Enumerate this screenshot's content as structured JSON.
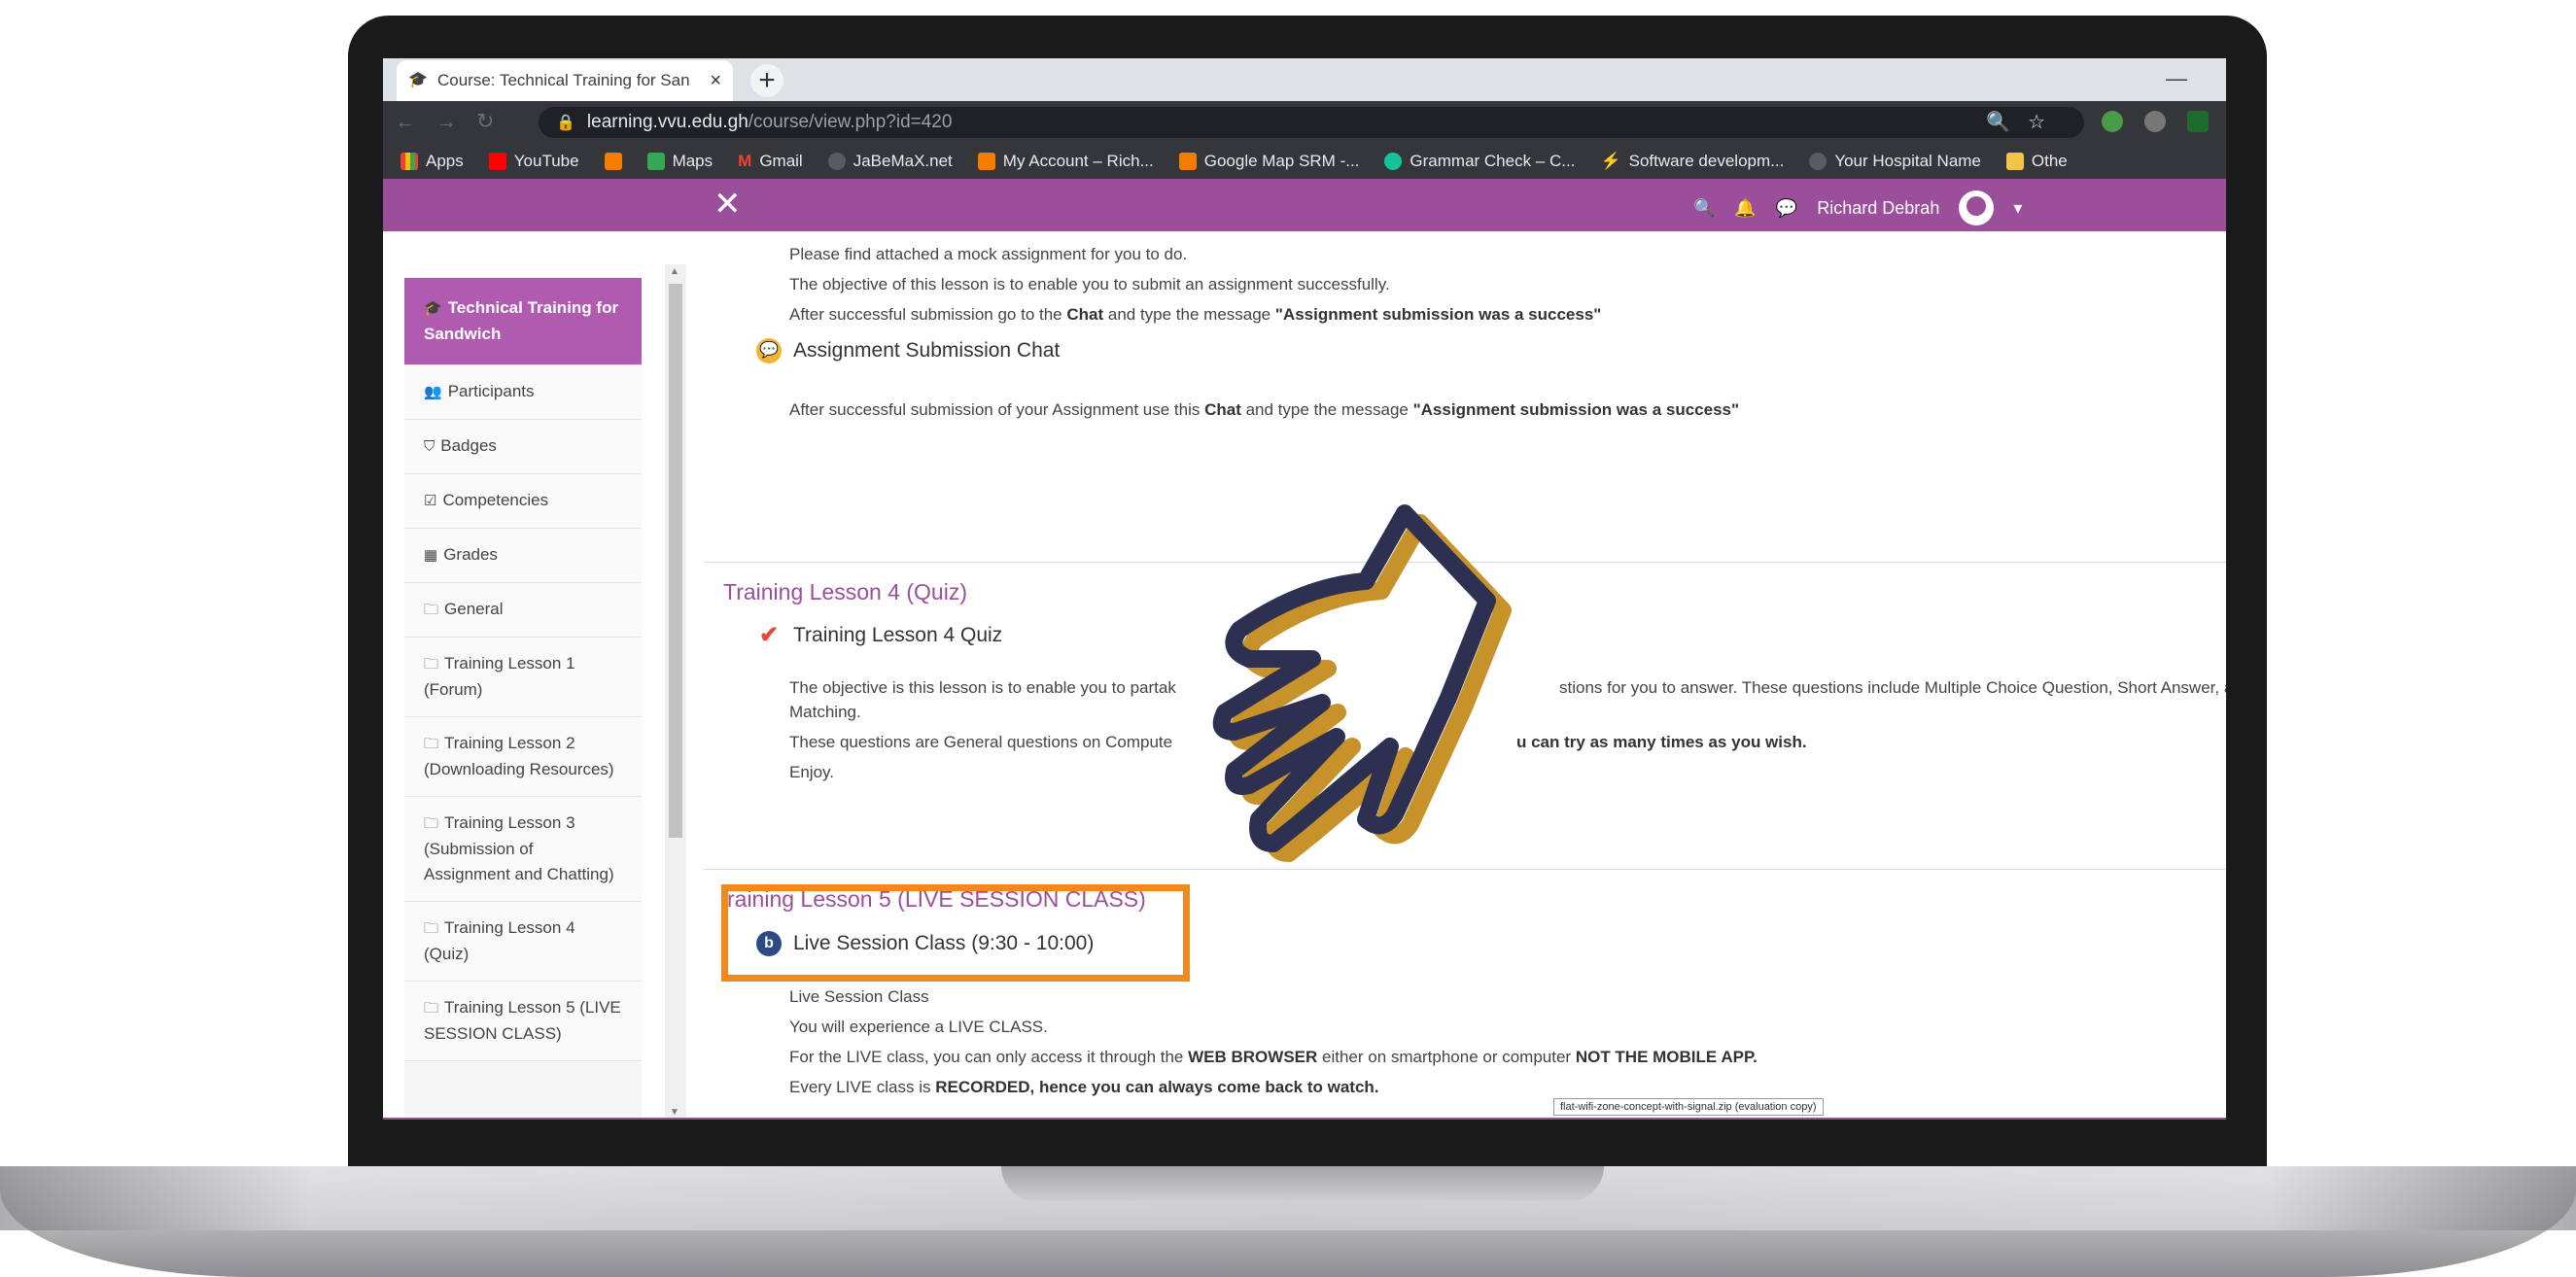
{
  "browser": {
    "tab_title": "Course: Technical Training for San",
    "new_tab": "+",
    "url_host": "learning.vvu.edu.gh",
    "url_path": "/course/view.php?id=420",
    "bookmarks": [
      "Apps",
      "YouTube",
      "Maps",
      "Gmail",
      "JaBeMaX.net",
      "My Account – Rich...",
      "Google Map SRM -...",
      "Grammar Check – C...",
      "Software developm...",
      "Your Hospital Name",
      "Othe"
    ]
  },
  "nav": {
    "user_name": "Richard Debrah"
  },
  "sidebar": {
    "items": [
      "Technical Training for Sandwich",
      "Participants",
      "Badges",
      "Competencies",
      "Grades",
      "General",
      "Training Lesson 1 (Forum)",
      "Training Lesson 2 (Downloading Resources)",
      "Training Lesson 3 (Submission of Assignment and Chatting)",
      "Training Lesson 4 (Quiz)",
      "Training Lesson 5 (LIVE SESSION CLASS)"
    ]
  },
  "content": {
    "line1": "Please find attached a mock assignment for you to do.",
    "line2": "The objective of this lesson is to enable you to submit an assignment successfully.",
    "line3_a": "After successful submission go to the ",
    "line3_b": "Chat",
    "line3_c": "  and type the message ",
    "line3_d": "\"Assignment submission was a success\"",
    "chat_activity": "Assignment Submission Chat",
    "chat_desc_a": "After successful submission of your Assignment use this ",
    "chat_desc_b": "Chat",
    "chat_desc_c": "  and type the message ",
    "chat_desc_d": "\"Assignment submission was a success\"",
    "section4_title": "Training Lesson 4 (Quiz)",
    "quiz_activity": "Training Lesson 4 Quiz",
    "quiz_desc1_a": "The objective is this lesson is to enable you to partak",
    "quiz_desc1_b": "stions for you to answer. These questions include Multiple Choice Question, Short Answer, and",
    "quiz_desc1_c": "Matching.",
    "quiz_desc2_a": "These questions are General questions on Compute",
    "quiz_desc2_b": "u can try as many times as you wish.",
    "quiz_desc3": "Enjoy.",
    "section5_title": "raining Lesson 5 (LIVE SESSION CLASS)",
    "live_activity": "Live Session Class (9:30 - 10:00)",
    "live_desc1": "Live Session Class",
    "live_desc2": "You will experience a LIVE CLASS.",
    "live_desc3_a": "For the LIVE class, you can only access it through the ",
    "live_desc3_b": "WEB BROWSER",
    "live_desc3_c": " either on smartphone or computer ",
    "live_desc3_d": "NOT THE MOBILE APP.",
    "live_desc4_a": "Every LIVE class is ",
    "live_desc4_b": "RECORDED, hence you can always come back to watch.",
    "tooltip": "flat-wifi-zone-concept-with-signal.zip (evaluation copy)"
  },
  "colors": {
    "moodle_purple": "#9b4f9b",
    "highlight_orange": "#f08a1c",
    "hand_navy": "#2e3052",
    "hand_gold": "#c8922a"
  }
}
